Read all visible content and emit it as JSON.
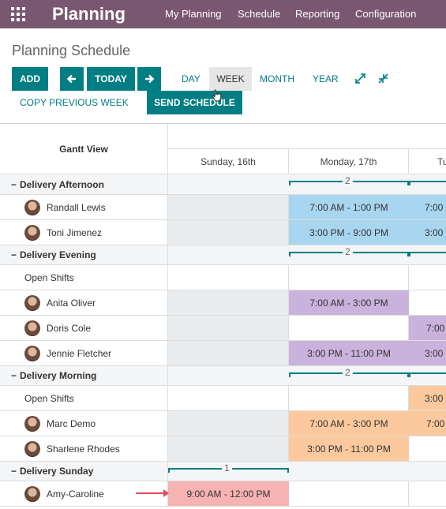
{
  "app": {
    "name": "Planning"
  },
  "nav": [
    "My Planning",
    "Schedule",
    "Reporting",
    "Configuration"
  ],
  "page": {
    "title": "Planning Schedule"
  },
  "toolbar": {
    "add": "ADD",
    "today": "TODAY",
    "day": "DAY",
    "week": "WEEK",
    "month": "MONTH",
    "year": "YEAR",
    "copy_previous_week": "COPY PREVIOUS WEEK",
    "send_schedule": "SEND SCHEDULE"
  },
  "gantt": {
    "title": "Gantt View",
    "days": [
      "Sunday, 16th",
      "Monday, 17th",
      "Tu"
    ],
    "groups": {
      "afternoon": {
        "label": "Delivery Afternoon",
        "count": "2"
      },
      "evening": {
        "label": "Delivery Evening",
        "count": "2"
      },
      "morning": {
        "label": "Delivery Morning",
        "count": "2"
      },
      "sunday": {
        "label": "Delivery Sunday",
        "count": "1"
      }
    },
    "rows": {
      "randall": {
        "name": "Randall Lewis",
        "mon": "7:00 AM - 1:00 PM",
        "tue": "7:00"
      },
      "toni": {
        "name": "Toni Jimenez",
        "mon": "3:00 PM - 9:00 PM",
        "tue": "3:00"
      },
      "open_evening": {
        "name": "Open Shifts"
      },
      "anita": {
        "name": "Anita Oliver",
        "mon": "7:00 AM - 3:00 PM"
      },
      "doris": {
        "name": "Doris Cole",
        "tue": "7:00"
      },
      "jennie": {
        "name": "Jennie Fletcher",
        "mon": "3:00 PM - 11:00 PM",
        "tue": "3:00"
      },
      "open_morning": {
        "name": "Open Shifts",
        "tue": "3:00"
      },
      "marc": {
        "name": "Marc Demo",
        "mon": "7:00 AM - 3:00 PM",
        "tue": "7:00"
      },
      "sharlene": {
        "name": "Sharlene Rhodes",
        "mon": "3:00 PM - 11:00 PM"
      },
      "amy": {
        "name": "Amy-Caroline",
        "sun": "9:00 AM - 12:00 PM"
      }
    }
  },
  "colors": {
    "accent": "#017e84",
    "topbar": "#7a5770",
    "blue": "#a8d5ef",
    "purple": "#c9b3dd",
    "orange": "#fbc99d",
    "red": "#f6b3b1"
  }
}
